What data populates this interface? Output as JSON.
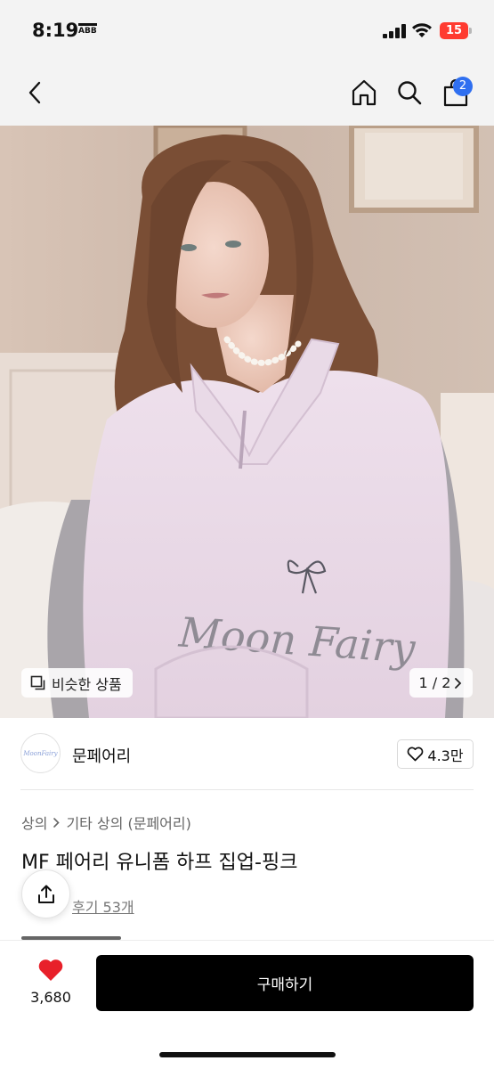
{
  "status_bar": {
    "time": "8:19",
    "carrier_badge": "ABB",
    "battery": "15",
    "battery_color": "#ff3b30"
  },
  "nav": {
    "back_icon": "chevron-left-icon",
    "home_icon": "home-icon",
    "search_icon": "search-icon",
    "cart_icon": "shopping-bag-icon",
    "cart_count": "2",
    "badge_color": "#2f6ff0"
  },
  "gallery": {
    "similar_label": "비슷한 상품",
    "page_indicator": "1 / 2"
  },
  "brand": {
    "name": "문페어리",
    "logo_text": "MoonFairy",
    "likes": "4.3만"
  },
  "product": {
    "breadcrumb": [
      "상의",
      "기타 상의 (문페어리)"
    ],
    "title": "MF 페어리 유니폼 하프 집업-핑크",
    "review_link": "후기 53개"
  },
  "bottom": {
    "wish_count": "3,680",
    "buy_label": "구매하기",
    "heart_color": "#e8202a"
  }
}
